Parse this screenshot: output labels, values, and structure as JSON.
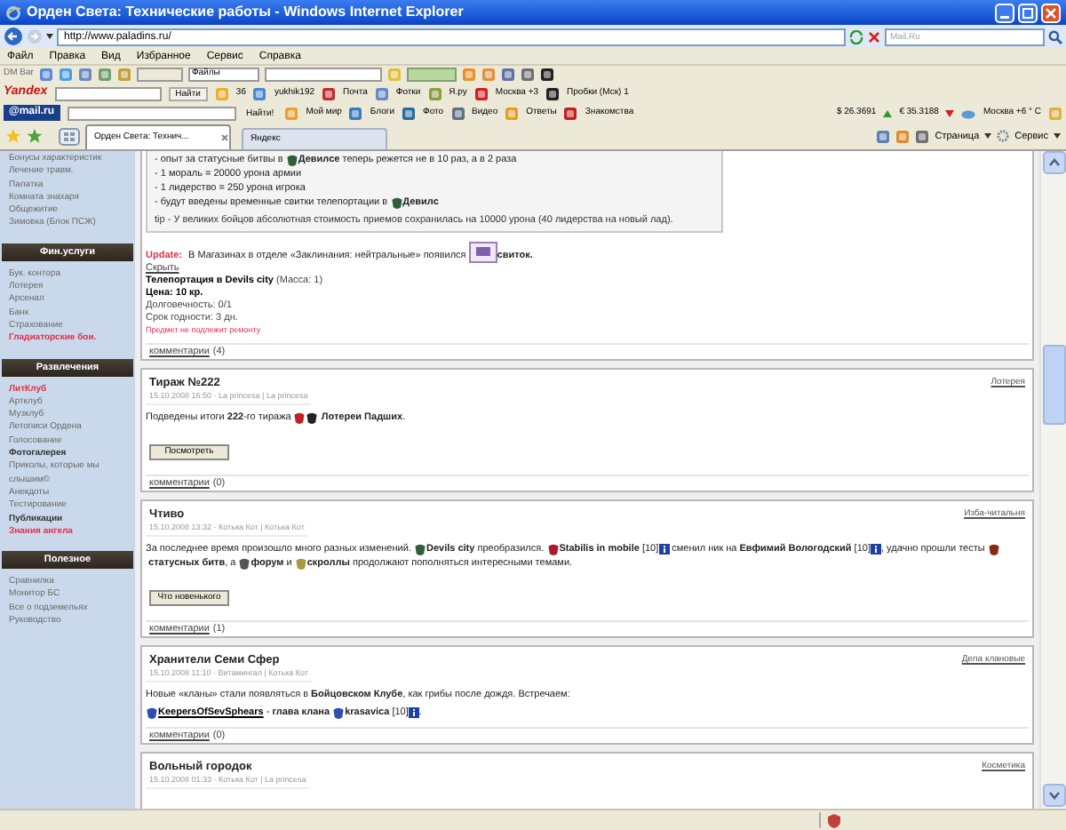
{
  "window": {
    "title": "Орден Света: Технические работы - Windows Internet Explorer"
  },
  "address_bar": {
    "url": "http://www.paladins.ru/",
    "search_placeholder": "Mail.Ru"
  },
  "menu": [
    "Файл",
    "Правка",
    "Вид",
    "Избранное",
    "Сервис",
    "Справка"
  ],
  "dm_bar": {
    "label": "DM Bar",
    "dropdown": "Файлы"
  },
  "yandex_bar": {
    "logo": "Yandex",
    "search_button": "Найти",
    "items": [
      "36",
      "yukhik192",
      "Почта",
      "Фотки",
      "Я.ру",
      "Москва +3",
      "Пробки (Мск) 1"
    ]
  },
  "mail_bar": {
    "logo": "@mail.ru",
    "search_button": "Найти!",
    "items": [
      "Мой мир",
      "Блоги",
      "Фото",
      "Видео",
      "Ответы",
      "Знакомства"
    ],
    "rates": [
      {
        "text": "$ 26.3691",
        "rising": true
      },
      {
        "text": "€ 35.3188",
        "rising": false
      }
    ],
    "weather": "Москва +6 ° C"
  },
  "tabs": [
    {
      "label": "Орден Света: Технич...",
      "selected": true
    },
    {
      "label": "Яндекс",
      "selected": false
    }
  ],
  "command_bar": [
    "Страница",
    "Сервис"
  ],
  "sidebar": [
    {
      "items": [
        {
          "label": "Бонусы характеристик",
          "kind": "normal"
        },
        {
          "label": "Лечение травм.",
          "kind": "normal"
        },
        {
          "label": "Палатка",
          "kind": "normal"
        },
        {
          "label": "Комната знахаря",
          "kind": "normal"
        },
        {
          "label": "Общежитие",
          "kind": "normal"
        },
        {
          "label": "Зимовка (Блок ПСЖ)",
          "kind": "normal"
        }
      ]
    },
    {
      "header": "Фин.услуги",
      "items": [
        {
          "label": "Бук. контора",
          "kind": "normal"
        },
        {
          "label": "Лотерея",
          "kind": "normal"
        },
        {
          "label": "Арсенал",
          "kind": "normal"
        },
        {
          "label": "Банк",
          "kind": "normal"
        },
        {
          "label": "Страхование",
          "kind": "normal"
        },
        {
          "label": "Гладиаторские бои.",
          "kind": "highlight"
        }
      ]
    },
    {
      "header": "Развлечения",
      "items": [
        {
          "label": "ЛитКлуб",
          "kind": "highlight"
        },
        {
          "label": "Артклуб",
          "kind": "normal"
        },
        {
          "label": "Музклуб",
          "kind": "normal"
        },
        {
          "label": "Летописи Ордена",
          "kind": "normal"
        },
        {
          "label": "Голосование",
          "kind": "normal"
        },
        {
          "label": "Фотогалерея",
          "kind": "bold"
        },
        {
          "label": "Приколы, которые мы слышим©",
          "kind": "normal"
        },
        {
          "label": "Анекдоты",
          "kind": "normal"
        },
        {
          "label": "Тестирование",
          "kind": "normal"
        },
        {
          "label": "Публикации",
          "kind": "bold"
        },
        {
          "label": "Знания ангела",
          "kind": "highlight"
        }
      ]
    },
    {
      "header": "Полезное",
      "items": [
        {
          "label": "Сравнилка",
          "kind": "normal"
        },
        {
          "label": "Монитор БС",
          "kind": "normal"
        },
        {
          "label": "Все о подземельях",
          "kind": "normal"
        },
        {
          "label": "Руководство",
          "kind": "normal"
        }
      ]
    }
  ],
  "first_post": {
    "notice": [
      [
        {
          "kind": "text",
          "text": "- опыт за статусные битвы в "
        },
        {
          "kind": "icon",
          "color": "#2f5f3a"
        },
        {
          "kind": "text",
          "text": "**Девилсе** теперь режется не в 10 раз, а в 2 раза"
        }
      ],
      [
        {
          "kind": "text",
          "text": "- 1 мораль = 20000 урона армии"
        }
      ],
      [
        {
          "kind": "text",
          "text": "- 1 лидерство = 250 урона игрока"
        }
      ],
      [
        {
          "kind": "text",
          "text": "- будут введены временные свитки телепортации в "
        },
        {
          "kind": "icon",
          "color": "#2f5f3a"
        },
        {
          "kind": "text",
          "text": "**Девилс**"
        }
      ]
    ],
    "tip": "tip - У великих бойцов абсолютная стоимость приемов сохранилась на 10000 урона (40 лидерства на новый лад).",
    "update": {
      "label": "Update:",
      "text": " В Магазинах в отделе «Заклинания: нейтральные» появился ",
      "item": "свиток.",
      "hide_link": "Скрыть",
      "item_name": "Телепортация в Devils city",
      "item_mass": " (Масса: 1)",
      "price": "Цена: 10 кр.",
      "lines": [
        "Долговечность: 0/1",
        "Срок годности: 3 дн."
      ],
      "warning": "Предмет не подлежит ремонту"
    },
    "comments_label": "комментарии",
    "comments_count": "(4)"
  },
  "posts": [
    {
      "title": "Тираж №222",
      "meta": "15.10.2008 16:50 · La princesa | La princesa",
      "category": "Лотерея",
      "body": [
        [
          {
            "kind": "text",
            "text": "Подведены итоги **222**-го тиража "
          },
          {
            "kind": "icon",
            "color": "#c0202a"
          },
          {
            "kind": "icon",
            "color": "#222222"
          },
          {
            "kind": "text",
            "text": " **Лотереи Падших**."
          }
        ]
      ],
      "button": "Посмотреть",
      "comments_label": "комментарии",
      "comments_count": "(0)"
    },
    {
      "title": "Чтиво",
      "meta": "15.10.2008 13:32 · Котька Кот | Котька Кот",
      "category": "Изба-читальня",
      "body": [
        [
          {
            "kind": "text",
            "text": "За последнее время произошло много разных изменений. "
          },
          {
            "kind": "icon",
            "color": "#2f5f3a"
          },
          {
            "kind": "text",
            "text": "**Devils city** преобразился. "
          },
          {
            "kind": "icon",
            "color": "#b01828"
          },
          {
            "kind": "text",
            "text": "**Stabilis in mobile** [10]"
          },
          {
            "kind": "info"
          },
          {
            "kind": "text",
            "text": " сменил ник на **Евфимий Вологодский** [10]"
          },
          {
            "kind": "info"
          },
          {
            "kind": "text",
            "text": ", удачно прошли "
          },
          {
            "kind": "text",
            "text": "тесты "
          },
          {
            "kind": "icon",
            "color": "#8a2a10"
          },
          {
            "kind": "text",
            "text": " **статусных битв**, а "
          },
          {
            "kind": "icon",
            "color": "#555555"
          },
          {
            "kind": "text",
            "text": "**форум** и "
          },
          {
            "kind": "icon",
            "color": "#a89a40"
          },
          {
            "kind": "text",
            "text": "**скроллы** продолжают пополняться интересными темами."
          }
        ]
      ],
      "button": "Что новенького",
      "comments_label": "комментарии",
      "comments_count": "(1)"
    },
    {
      "title": "Хранители Семи Сфер",
      "meta": "15.10.2008 11:10 · Витамингал | Котька Кот",
      "category": "Дела клановые",
      "body": [
        [
          {
            "kind": "text",
            "text": "Новые «кланы» стали появляться в **Бойцовском Клубе**, как грибы после дождя. Встречаем:"
          }
        ],
        [
          {
            "kind": "icon",
            "color": "#2a4fb0"
          },
          {
            "kind": "link",
            "text": "KeepersOfSevSphears"
          },
          {
            "kind": "text",
            "text": " - **глава клана** "
          },
          {
            "kind": "icon",
            "color": "#2a4fb0"
          },
          {
            "kind": "text",
            "text": "**krasavica** [10]"
          },
          {
            "kind": "info"
          },
          {
            "kind": "text",
            "text": "."
          }
        ]
      ],
      "comments_label": "комментарии",
      "comments_count": "(0)"
    },
    {
      "title": "Вольный городок",
      "meta": "15.10.2008 01:33 · Котька Кот | La princesa",
      "category": "Косметика"
    }
  ]
}
